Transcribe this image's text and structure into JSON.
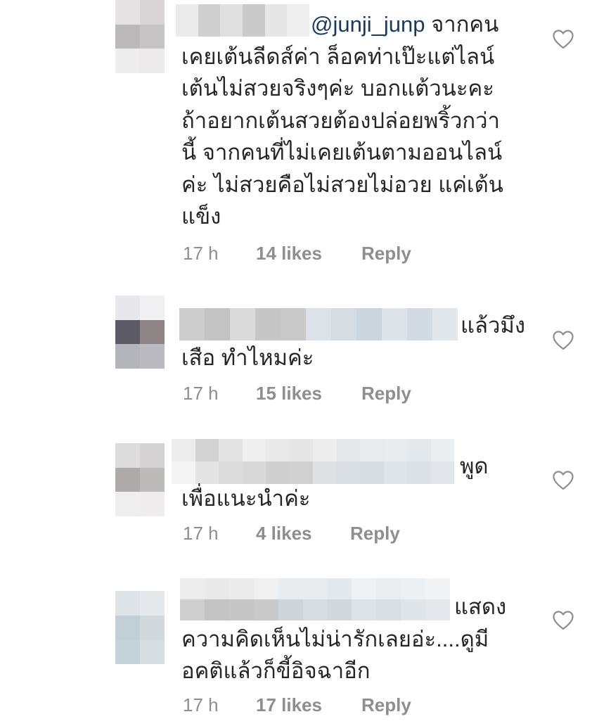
{
  "comments": [
    {
      "mention": "@junji_junp",
      "text_first": " จากคน",
      "text_rest": "เคยเต้นลีดส์ค่า ล็อคท่าเป๊ะแต่ไลน์\nเต้นไม่สวยจริงๆค่ะ บอกแต้วนะคะ\nถ้าอยากเต้นสวยต้องปล่อยพริ้วกว่า\nนี้ จากคนที่ไม่เคยเต้นตามออนไลน์\nค่ะ ไม่สวยคือไม่สวยไม่อวย แค่เต้น\nแข็ง",
      "time": "17 h",
      "likes": "14 likes",
      "reply": "Reply"
    },
    {
      "text_first": "แล้วมึง",
      "text_rest": "เสือ ทำไหมค่ะ",
      "time": "17 h",
      "likes": "15 likes",
      "reply": "Reply"
    },
    {
      "text_first": "พูด",
      "text_rest": "เพื่อแนะนำค่ะ",
      "time": "17 h",
      "likes": "4 likes",
      "reply": "Reply"
    },
    {
      "text_first": "แสดง",
      "text_rest": "ความคิดเห็นไม่น่ารักเลยอ่ะ....ดูมี\nอคติแล้วก็ขี้อิจฉาอีก",
      "time": "17 h",
      "likes": "17 likes",
      "reply": "Reply"
    }
  ],
  "icons": {
    "like": "heart-outline-icon"
  },
  "colors": {
    "text": "#262626",
    "meta": "#8e8e8e",
    "mention": "#1a3a5c",
    "heart_stroke": "#8e8e8e"
  }
}
